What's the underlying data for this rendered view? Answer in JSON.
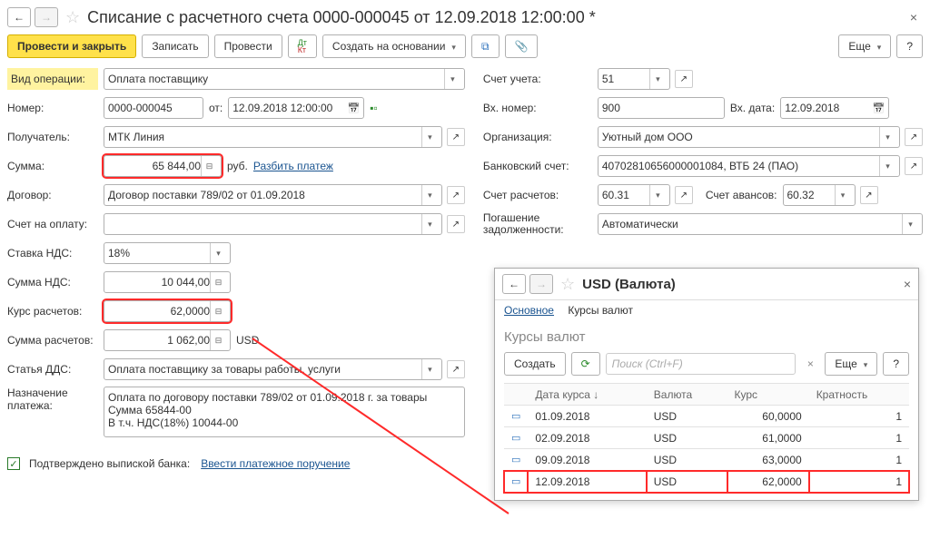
{
  "header": {
    "title": "Списание с расчетного счета 0000-000045 от 12.09.2018 12:00:00 *"
  },
  "toolbar": {
    "post_close": "Провести и закрыть",
    "save": "Записать",
    "post": "Провести",
    "create_based": "Создать на основании",
    "more": "Еще"
  },
  "labels": {
    "operation_type": "Вид операции:",
    "number": "Номер:",
    "from": "от:",
    "recipient": "Получатель:",
    "amount": "Сумма:",
    "currency_short": "руб.",
    "split_payment": "Разбить платеж",
    "contract": "Договор:",
    "invoice": "Счет на оплату:",
    "vat_rate": "Ставка НДС:",
    "vat_amount": "Сумма НДС:",
    "rate": "Курс расчетов:",
    "calc_amount": "Сумма расчетов:",
    "calc_currency": "USD",
    "dds": "Статья ДДС:",
    "purpose": "Назначение платежа:",
    "account": "Счет учета:",
    "ext_number": "Вх. номер:",
    "ext_date": "Вх. дата:",
    "organization": "Организация:",
    "bank_account": "Банковский счет:",
    "calc_account": "Счет расчетов:",
    "advance_account": "Счет авансов:",
    "debt": "Погашение задолженности:",
    "confirmed": "Подтверждено выпиской банка:",
    "enter_order": "Ввести платежное поручение"
  },
  "values": {
    "operation_type": "Оплата поставщику",
    "number": "0000-000045",
    "date": "12.09.2018 12:00:00",
    "recipient": "МТК Линия",
    "amount": "65 844,00",
    "contract": "Договор поставки 789/02 от 01.09.2018",
    "vat_rate": "18%",
    "vat_amount": "10 044,00",
    "rate": "62,0000",
    "calc_amount": "1 062,00",
    "dds": "Оплата поставщику за товары работы, услуги",
    "purpose": "Оплата по договору поставки 789/02 от 01.09.2018 г. за товары\nСумма 65844-00\nВ т.ч. НДС(18%) 10044-00",
    "account": "51",
    "ext_number": "900",
    "ext_date": "12.09.2018",
    "organization": "Уютный дом ООО",
    "bank_account": "40702810656000001084, ВТБ 24 (ПАО)",
    "calc_account": "60.31",
    "advance_account": "60.32",
    "debt": "Автоматически"
  },
  "popup": {
    "title": "USD (Валюта)",
    "tab_main": "Основное",
    "tab_rates": "Курсы валют",
    "subtitle": "Курсы валют",
    "create": "Создать",
    "search_placeholder": "Поиск (Ctrl+F)",
    "more": "Еще",
    "cols": {
      "date": "Дата курса",
      "currency": "Валюта",
      "rate": "Курс",
      "mult": "Кратность"
    },
    "rows": [
      {
        "date": "01.09.2018",
        "currency": "USD",
        "rate": "60,0000",
        "mult": "1"
      },
      {
        "date": "02.09.2018",
        "currency": "USD",
        "rate": "61,0000",
        "mult": "1"
      },
      {
        "date": "09.09.2018",
        "currency": "USD",
        "rate": "63,0000",
        "mult": "1"
      },
      {
        "date": "12.09.2018",
        "currency": "USD",
        "rate": "62,0000",
        "mult": "1"
      }
    ]
  }
}
